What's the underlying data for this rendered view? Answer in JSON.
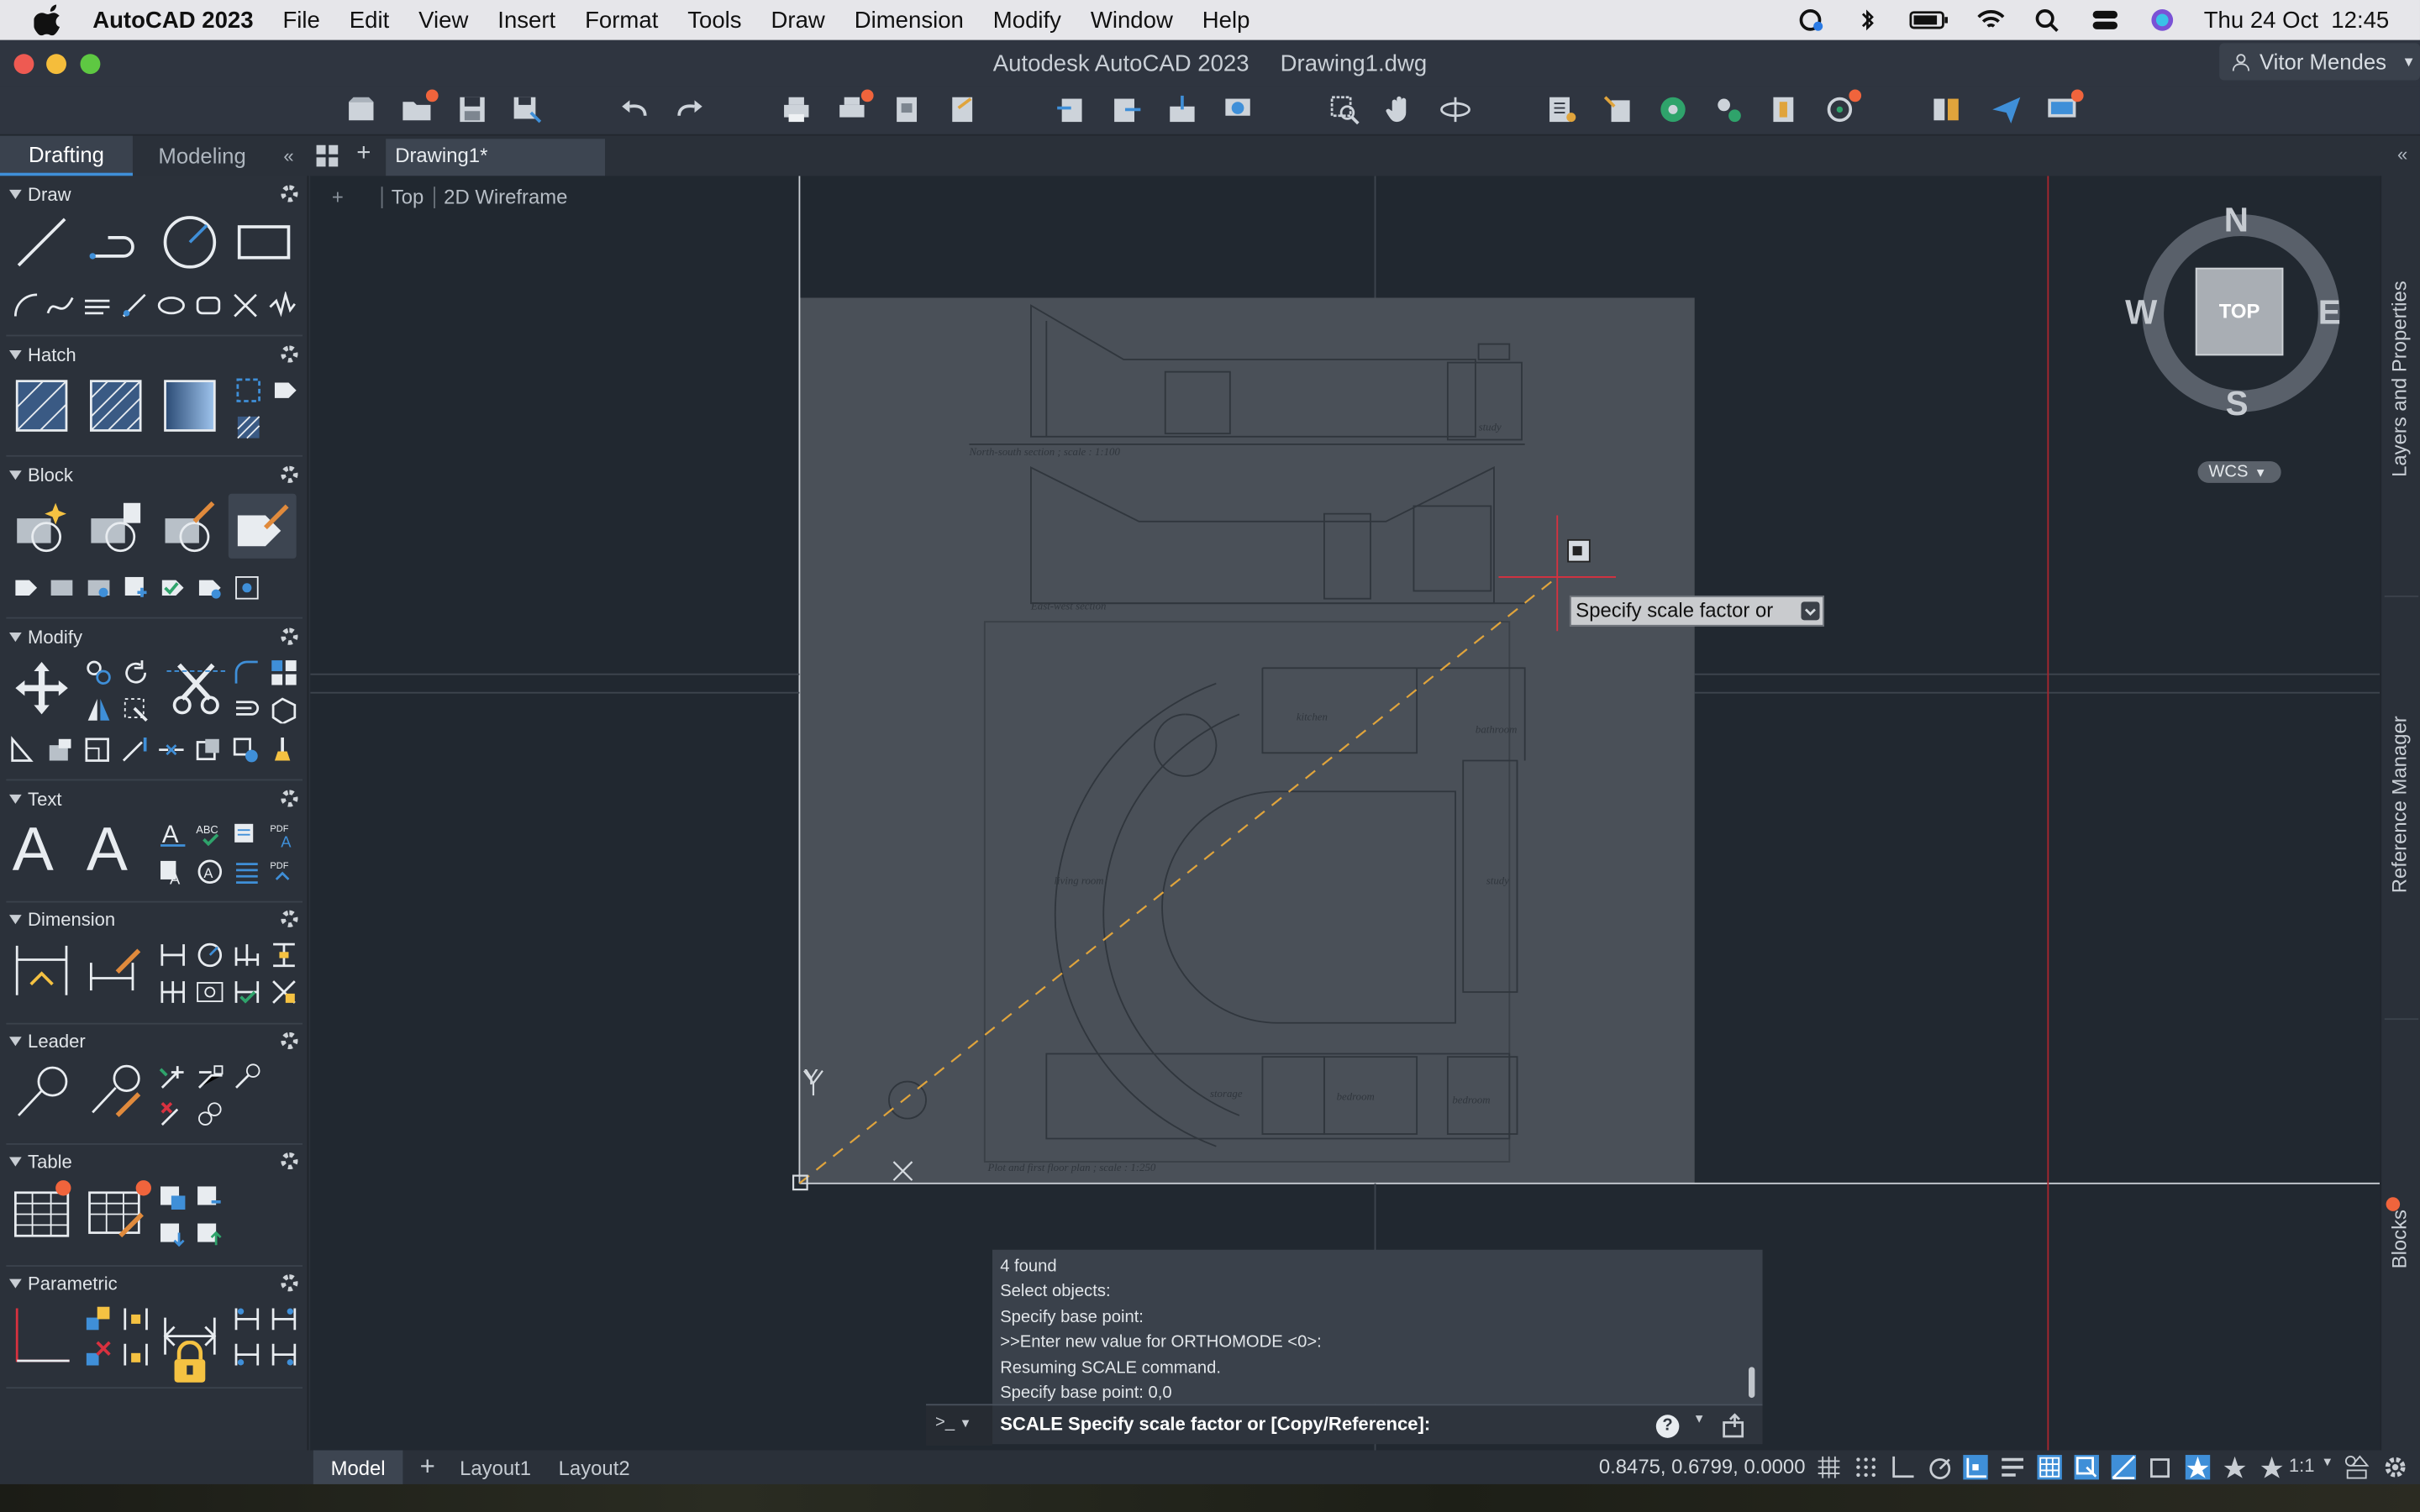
{
  "menubar": {
    "app_name": "AutoCAD 2023",
    "items": [
      "File",
      "Edit",
      "View",
      "Insert",
      "Format",
      "Tools",
      "Draw",
      "Dimension",
      "Modify",
      "Window",
      "Help"
    ],
    "datetime": "Thu 24 Oct  12:45"
  },
  "window": {
    "title_app": "Autodesk AutoCAD 2023",
    "title_file": "Drawing1.dwg",
    "user": "Vitor Mendes"
  },
  "workspace_tabs": [
    "Drafting",
    "Modeling"
  ],
  "document_tab": "Drawing1*",
  "palette": {
    "sections": [
      "Draw",
      "Hatch",
      "Block",
      "Modify",
      "Text",
      "Dimension",
      "Leader",
      "Table",
      "Parametric"
    ]
  },
  "viewport": {
    "plus": "+",
    "view": "Top",
    "visual_style": "2D Wireframe",
    "ucs_y": "Y",
    "ucs_x": "X"
  },
  "viewcube": {
    "north": "N",
    "south": "S",
    "east": "E",
    "west": "W",
    "face": "TOP",
    "wcs": "WCS"
  },
  "drawing_labels": {
    "section1": "North-south section ; scale : 1:100",
    "section2": "East-west section",
    "plan": "Plot and first floor plan ; scale : 1:250",
    "kitchen": "kitchen",
    "bathroom": "bathroom",
    "study": "study",
    "study2": "study",
    "livingroom": "living room",
    "bedroom": "bedroom",
    "bedroom2": "bedroom",
    "storage": "storage"
  },
  "tooltip": "Specify scale factor or",
  "command_history": [
    "4 found",
    "Select objects:",
    "Specify base point:",
    ">>Enter new value for ORTHOMODE <0>:",
    "Resuming SCALE command.",
    "Specify base point: 0,0"
  ],
  "command_prompt_symbol": ">_",
  "command_line": "SCALE Specify scale factor or [Copy/Reference]:",
  "right_panels": [
    "Layers and Properties",
    "Reference Manager",
    "Blocks"
  ],
  "status": {
    "tabs": [
      "Model",
      "Layout1",
      "Layout2"
    ],
    "coordinates": "0.8475, 0.6799, 0.0000",
    "annotation_scale": "1:1"
  },
  "colors": {
    "accent": "#3f8fd8",
    "notification": "#f0643c",
    "crosshair_red": "#d8313f",
    "rubberband": "#e0a43c"
  }
}
